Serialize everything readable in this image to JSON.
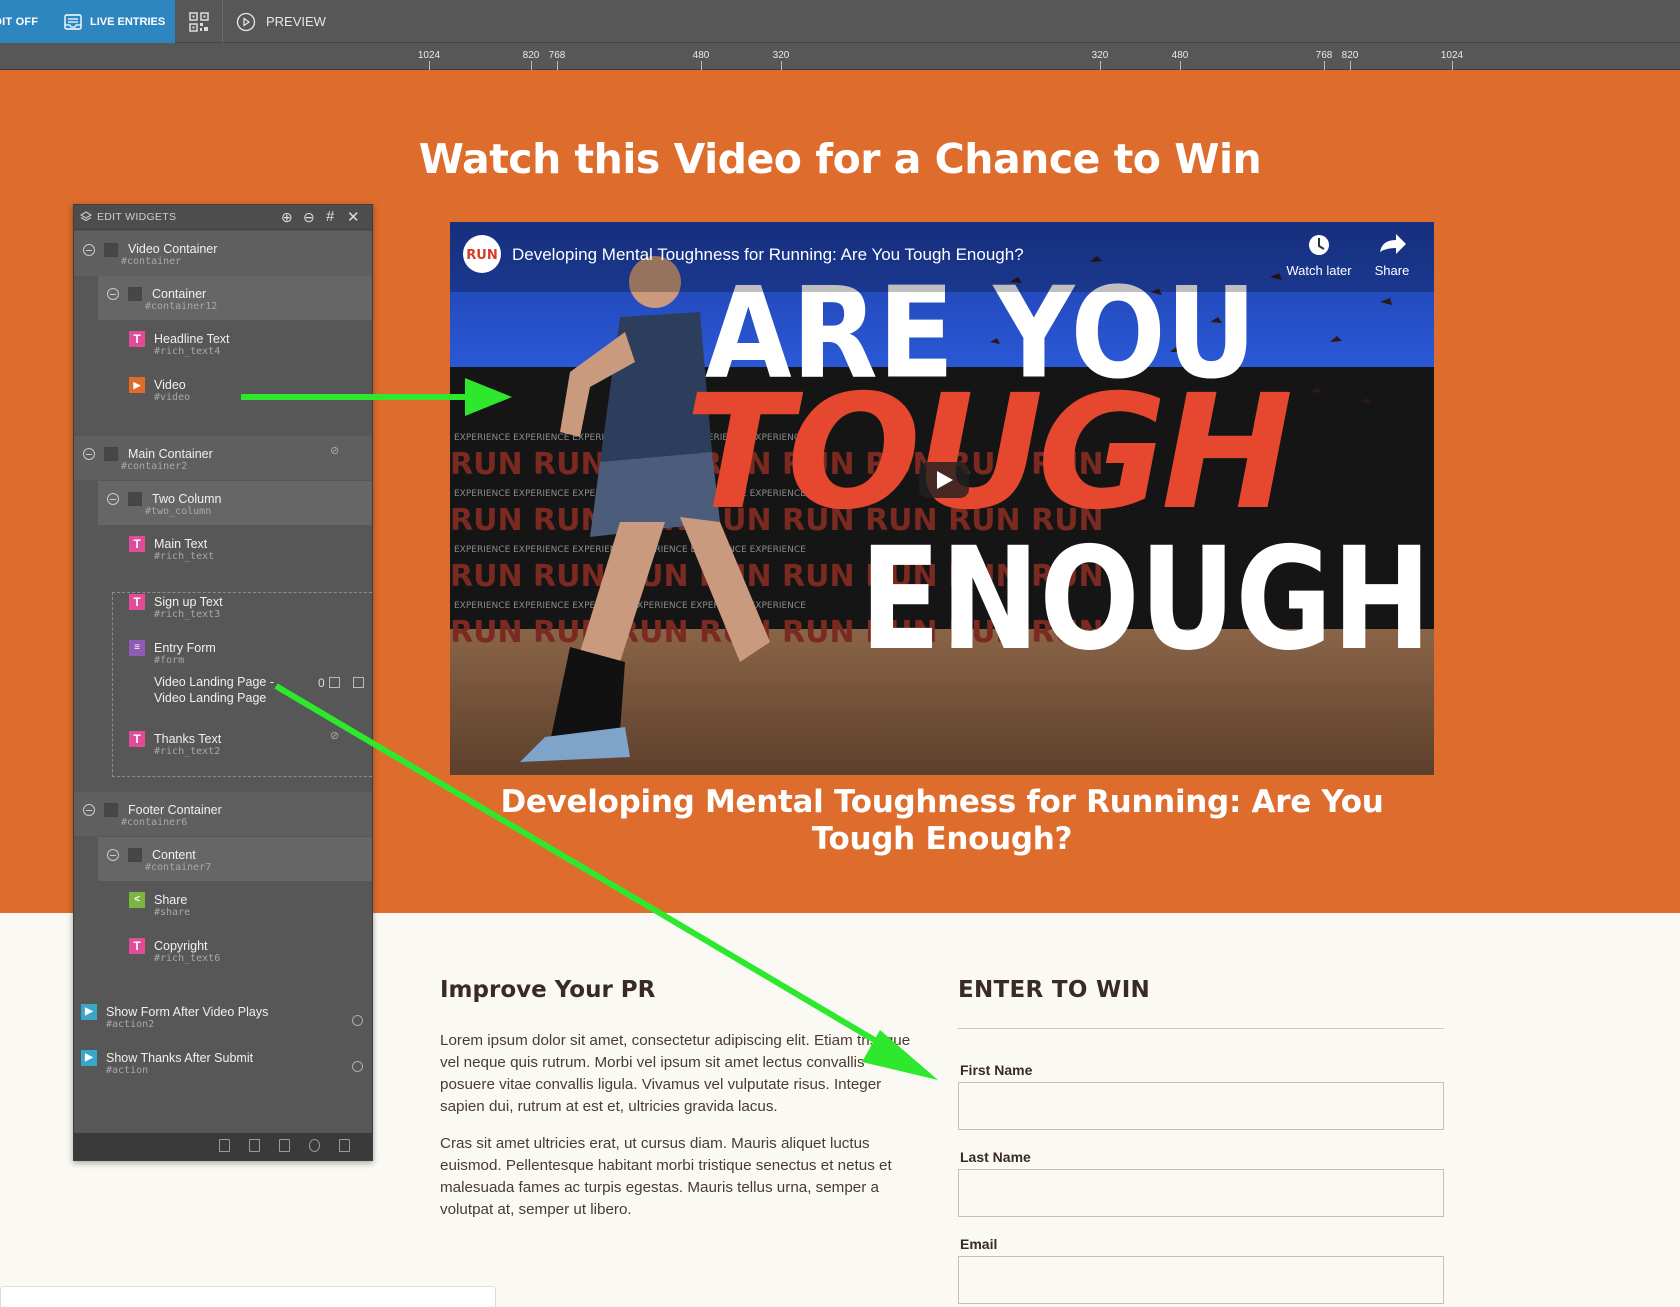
{
  "toolbar": {
    "edit_toggle": "DIT OFF",
    "live_entries": "LIVE ENTRIES",
    "preview": "PREVIEW"
  },
  "ruler": {
    "ticks": [
      "1024",
      "820",
      "768",
      "480",
      "320",
      "320",
      "480",
      "768",
      "820",
      "1024"
    ]
  },
  "hero": {
    "title": "Watch this Video for a Chance to Win",
    "video": {
      "channel_logo": "RUN",
      "title": "Developing Mental Toughness for Running: Are You Tough Enough?",
      "watch_later": "Watch later",
      "share": "Share",
      "thumb_line1": "ARE YOU",
      "thumb_line2": "TOUGH",
      "thumb_line3": "ENOUGH?"
    },
    "caption": "Developing Mental Toughness for Running: Are You Tough Enough?"
  },
  "content": {
    "improve_title": "Improve Your PR",
    "para1": "Lorem ipsum dolor sit amet, consectetur adipiscing elit. Etiam tristique vel neque quis rutrum. Morbi vel ipsum sit amet lectus convallis posuere vitae convallis ligula. Vivamus vel vulputate risus. Integer sapien dui, rutrum at est et, ultricies gravida lacus.",
    "para2": "Cras sit amet ultricies erat, ut cursus diam. Mauris aliquet luctus euismod. Pellentesque habitant morbi tristique senectus et netus et malesuada fames ac turpis egestas. Mauris tellus urna, semper a volutpat at, semper ut libero."
  },
  "form": {
    "title": "ENTER TO WIN",
    "first_name": "First Name",
    "last_name": "Last Name",
    "email": "Email"
  },
  "panel": {
    "title": "EDIT WIDGETS",
    "items": [
      {
        "name": "Video Container",
        "id": "#container"
      },
      {
        "name": "Container",
        "id": "#container12"
      },
      {
        "name": "Headline Text",
        "id": "#rich_text4"
      },
      {
        "name": "Video",
        "id": "#video"
      },
      {
        "name": "Main Container",
        "id": "#container2"
      },
      {
        "name": "Two Column",
        "id": "#two_column"
      },
      {
        "name": "Main Text",
        "id": "#rich_text"
      },
      {
        "name": "Sign up Text",
        "id": "#rich_text3"
      },
      {
        "name": "Entry Form",
        "id": "#form"
      },
      {
        "name": "Video Landing Page -",
        "id": "Video Landing Page"
      },
      {
        "name": "Thanks Text",
        "id": "#rich_text2"
      },
      {
        "name": "Footer Container",
        "id": "#container6"
      },
      {
        "name": "Content",
        "id": "#container7"
      },
      {
        "name": "Share",
        "id": "#share"
      },
      {
        "name": "Copyright",
        "id": "#rich_text6"
      },
      {
        "name": "Show Form After Video Plays",
        "id": "#action2"
      },
      {
        "name": "Show Thanks After Submit",
        "id": "#action"
      }
    ],
    "form_count": "0"
  }
}
